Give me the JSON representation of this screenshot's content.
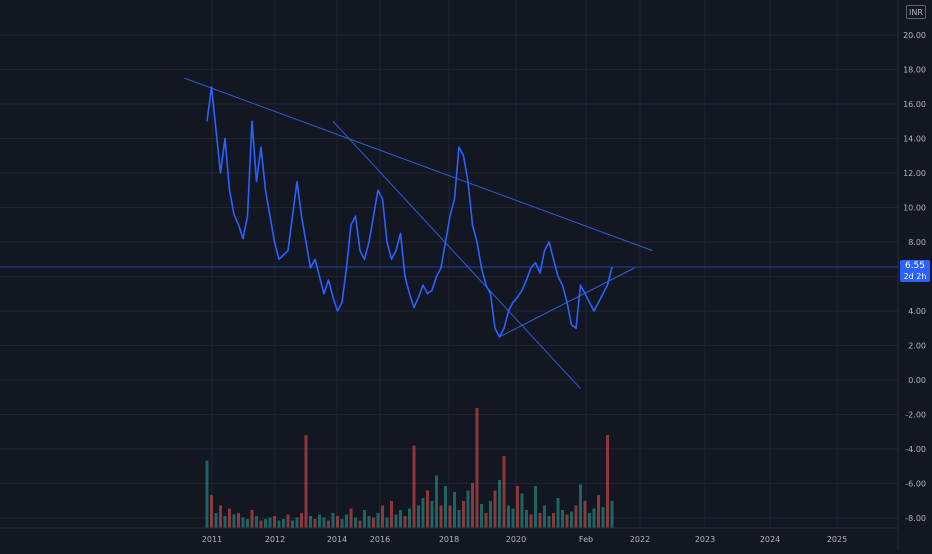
{
  "currency": "INR",
  "last_price_label": "6.55",
  "countdown_label": "2d 2h",
  "colors": {
    "background": "#131722",
    "grid": "#1f2433",
    "price_line": "#2962ff",
    "trendline": "#2a5fd8",
    "axis_text": "#b2b5be",
    "volume_up": "#26a69a",
    "volume_down": "#ef5350"
  },
  "chart_data": {
    "type": "line",
    "title": "",
    "xlabel": "",
    "ylabel": "",
    "x_ticks": [
      "2011",
      "2012",
      "2014",
      "2016",
      "2018",
      "2020",
      "Feb",
      "2022",
      "2023",
      "2024",
      "2025"
    ],
    "y_ticks": [
      "20.00",
      "18.00",
      "16.00",
      "14.00",
      "12.00",
      "10.00",
      "8.00",
      "6.00",
      "4.00",
      "2.00",
      "0.00",
      "-2.00",
      "-4.00",
      "-6.00",
      "-8.00"
    ],
    "ylim": [
      -9,
      21
    ],
    "grid": true,
    "last_price": 6.55,
    "series": [
      {
        "values": [
          [
            0,
            15
          ],
          [
            1,
            17
          ],
          [
            3,
            12
          ],
          [
            4,
            14
          ],
          [
            5,
            11
          ],
          [
            6,
            9.6
          ],
          [
            7,
            9
          ],
          [
            8,
            8.2
          ],
          [
            9,
            9.5
          ],
          [
            10,
            15
          ],
          [
            11,
            11.5
          ],
          [
            12,
            13.5
          ],
          [
            13,
            11
          ],
          [
            14,
            9.5
          ],
          [
            15,
            8
          ],
          [
            16,
            7
          ],
          [
            18,
            7.5
          ],
          [
            20,
            11.5
          ],
          [
            21,
            9.5
          ],
          [
            22,
            8
          ],
          [
            23,
            6.5
          ],
          [
            24,
            7
          ],
          [
            25,
            6
          ],
          [
            26,
            5
          ],
          [
            27,
            5.8
          ],
          [
            28,
            4.8
          ],
          [
            29,
            4
          ],
          [
            30,
            4.5
          ],
          [
            31,
            6.5
          ],
          [
            32,
            9
          ],
          [
            33,
            9.5
          ],
          [
            34,
            7.5
          ],
          [
            35,
            7
          ],
          [
            36,
            8
          ],
          [
            37,
            9.5
          ],
          [
            38,
            11
          ],
          [
            39,
            10.5
          ],
          [
            40,
            8
          ],
          [
            41,
            7
          ],
          [
            42,
            7.5
          ],
          [
            43,
            8.5
          ],
          [
            44,
            6
          ],
          [
            45,
            5
          ],
          [
            46,
            4.2
          ],
          [
            47,
            4.8
          ],
          [
            48,
            5.5
          ],
          [
            49,
            5
          ],
          [
            50,
            5.2
          ],
          [
            51,
            6
          ],
          [
            52,
            6.5
          ],
          [
            53,
            8
          ],
          [
            54,
            9.5
          ],
          [
            55,
            10.5
          ],
          [
            56,
            13.5
          ],
          [
            57,
            13
          ],
          [
            58,
            11.5
          ],
          [
            59,
            9
          ],
          [
            60,
            8
          ],
          [
            61,
            6.5
          ],
          [
            62,
            5.5
          ],
          [
            63,
            5
          ],
          [
            64,
            3
          ],
          [
            65,
            2.5
          ],
          [
            66,
            3
          ],
          [
            67,
            4
          ],
          [
            68,
            4.5
          ],
          [
            69,
            4.8
          ],
          [
            70,
            5.2
          ],
          [
            71,
            5.8
          ],
          [
            72,
            6.5
          ],
          [
            73,
            6.8
          ],
          [
            74,
            6.2
          ],
          [
            75,
            7.5
          ],
          [
            76,
            8
          ],
          [
            77,
            7
          ],
          [
            78,
            6
          ],
          [
            79,
            5.5
          ],
          [
            80,
            4.5
          ],
          [
            81,
            3.2
          ],
          [
            82,
            3
          ],
          [
            83,
            5.5
          ],
          [
            84,
            5
          ],
          [
            85,
            4.5
          ],
          [
            86,
            4
          ],
          [
            87,
            4.5
          ],
          [
            88,
            5
          ],
          [
            89,
            5.5
          ],
          [
            90,
            6.55
          ]
        ]
      }
    ],
    "volume": {
      "x": [
        0,
        1,
        2,
        3,
        4,
        5,
        6,
        7,
        8,
        9,
        10,
        11,
        12,
        13,
        14,
        15,
        16,
        17,
        18,
        19,
        20,
        21,
        22,
        23,
        24,
        25,
        26,
        27,
        28,
        29,
        30,
        31,
        32,
        33,
        34,
        35,
        36,
        37,
        38,
        39,
        40,
        41,
        42,
        43,
        44,
        45,
        46,
        47,
        48,
        49,
        50,
        51,
        52,
        53,
        54,
        55,
        56,
        57,
        58,
        59,
        60,
        61,
        62,
        63,
        64,
        65,
        66,
        67,
        68,
        69,
        70,
        71,
        72,
        73,
        74,
        75,
        76,
        77,
        78,
        79,
        80,
        81,
        82,
        83,
        84,
        85,
        86,
        87,
        88,
        89,
        90
      ],
      "values": [
        4.5,
        2.2,
        1,
        1.5,
        0.8,
        1.3,
        0.9,
        1,
        0.7,
        0.6,
        1.2,
        0.8,
        0.5,
        0.6,
        0.7,
        0.8,
        0.5,
        0.6,
        0.9,
        0.5,
        0.7,
        1,
        6.2,
        0.8,
        0.6,
        0.9,
        0.7,
        0.5,
        1,
        0.8,
        0.6,
        0.9,
        1.3,
        0.7,
        0.5,
        1.2,
        0.8,
        0.7,
        1,
        1.5,
        0.7,
        1.8,
        0.9,
        1.2,
        0.8,
        1.3,
        5.5,
        1.5,
        2,
        2.5,
        1.8,
        3.5,
        1.5,
        2.8,
        1.5,
        2.4,
        1.2,
        1.8,
        2.5,
        3,
        8,
        1.6,
        1,
        1.8,
        2.5,
        3.2,
        4.8,
        1.5,
        1.3,
        2.8,
        2.3,
        1.2,
        0.9,
        2.8,
        1,
        1.5,
        0.8,
        1,
        2,
        1.2,
        0.9,
        1.1,
        1.5,
        2.9,
        1.8,
        1,
        1.3,
        2.2,
        1.4,
        6.2,
        1.8
      ],
      "down": [
        false,
        true,
        false,
        true,
        false,
        true,
        false,
        true,
        false,
        false,
        true,
        false,
        true,
        false,
        false,
        true,
        false,
        false,
        true,
        false,
        false,
        true,
        true,
        false,
        true,
        false,
        false,
        true,
        false,
        true,
        false,
        false,
        true,
        false,
        true,
        false,
        false,
        true,
        false,
        true,
        false,
        true,
        false,
        false,
        true,
        false,
        true,
        false,
        false,
        true,
        false,
        false,
        true,
        false,
        true,
        false,
        false,
        true,
        false,
        true,
        true,
        false,
        true,
        false,
        true,
        false,
        true,
        false,
        false,
        true,
        false,
        false,
        true,
        false,
        true,
        false,
        false,
        true,
        false,
        false,
        true,
        false,
        true,
        false,
        true,
        false,
        false,
        true,
        false,
        true,
        false
      ]
    },
    "annotations": {
      "trendlines": [
        [
          [
            -5,
            17.5
          ],
          [
            99,
            7.5
          ]
        ],
        [
          [
            28,
            15
          ],
          [
            83,
            -0.5
          ]
        ],
        [
          [
            65,
            2.5
          ],
          [
            95,
            6.5
          ]
        ]
      ]
    }
  }
}
